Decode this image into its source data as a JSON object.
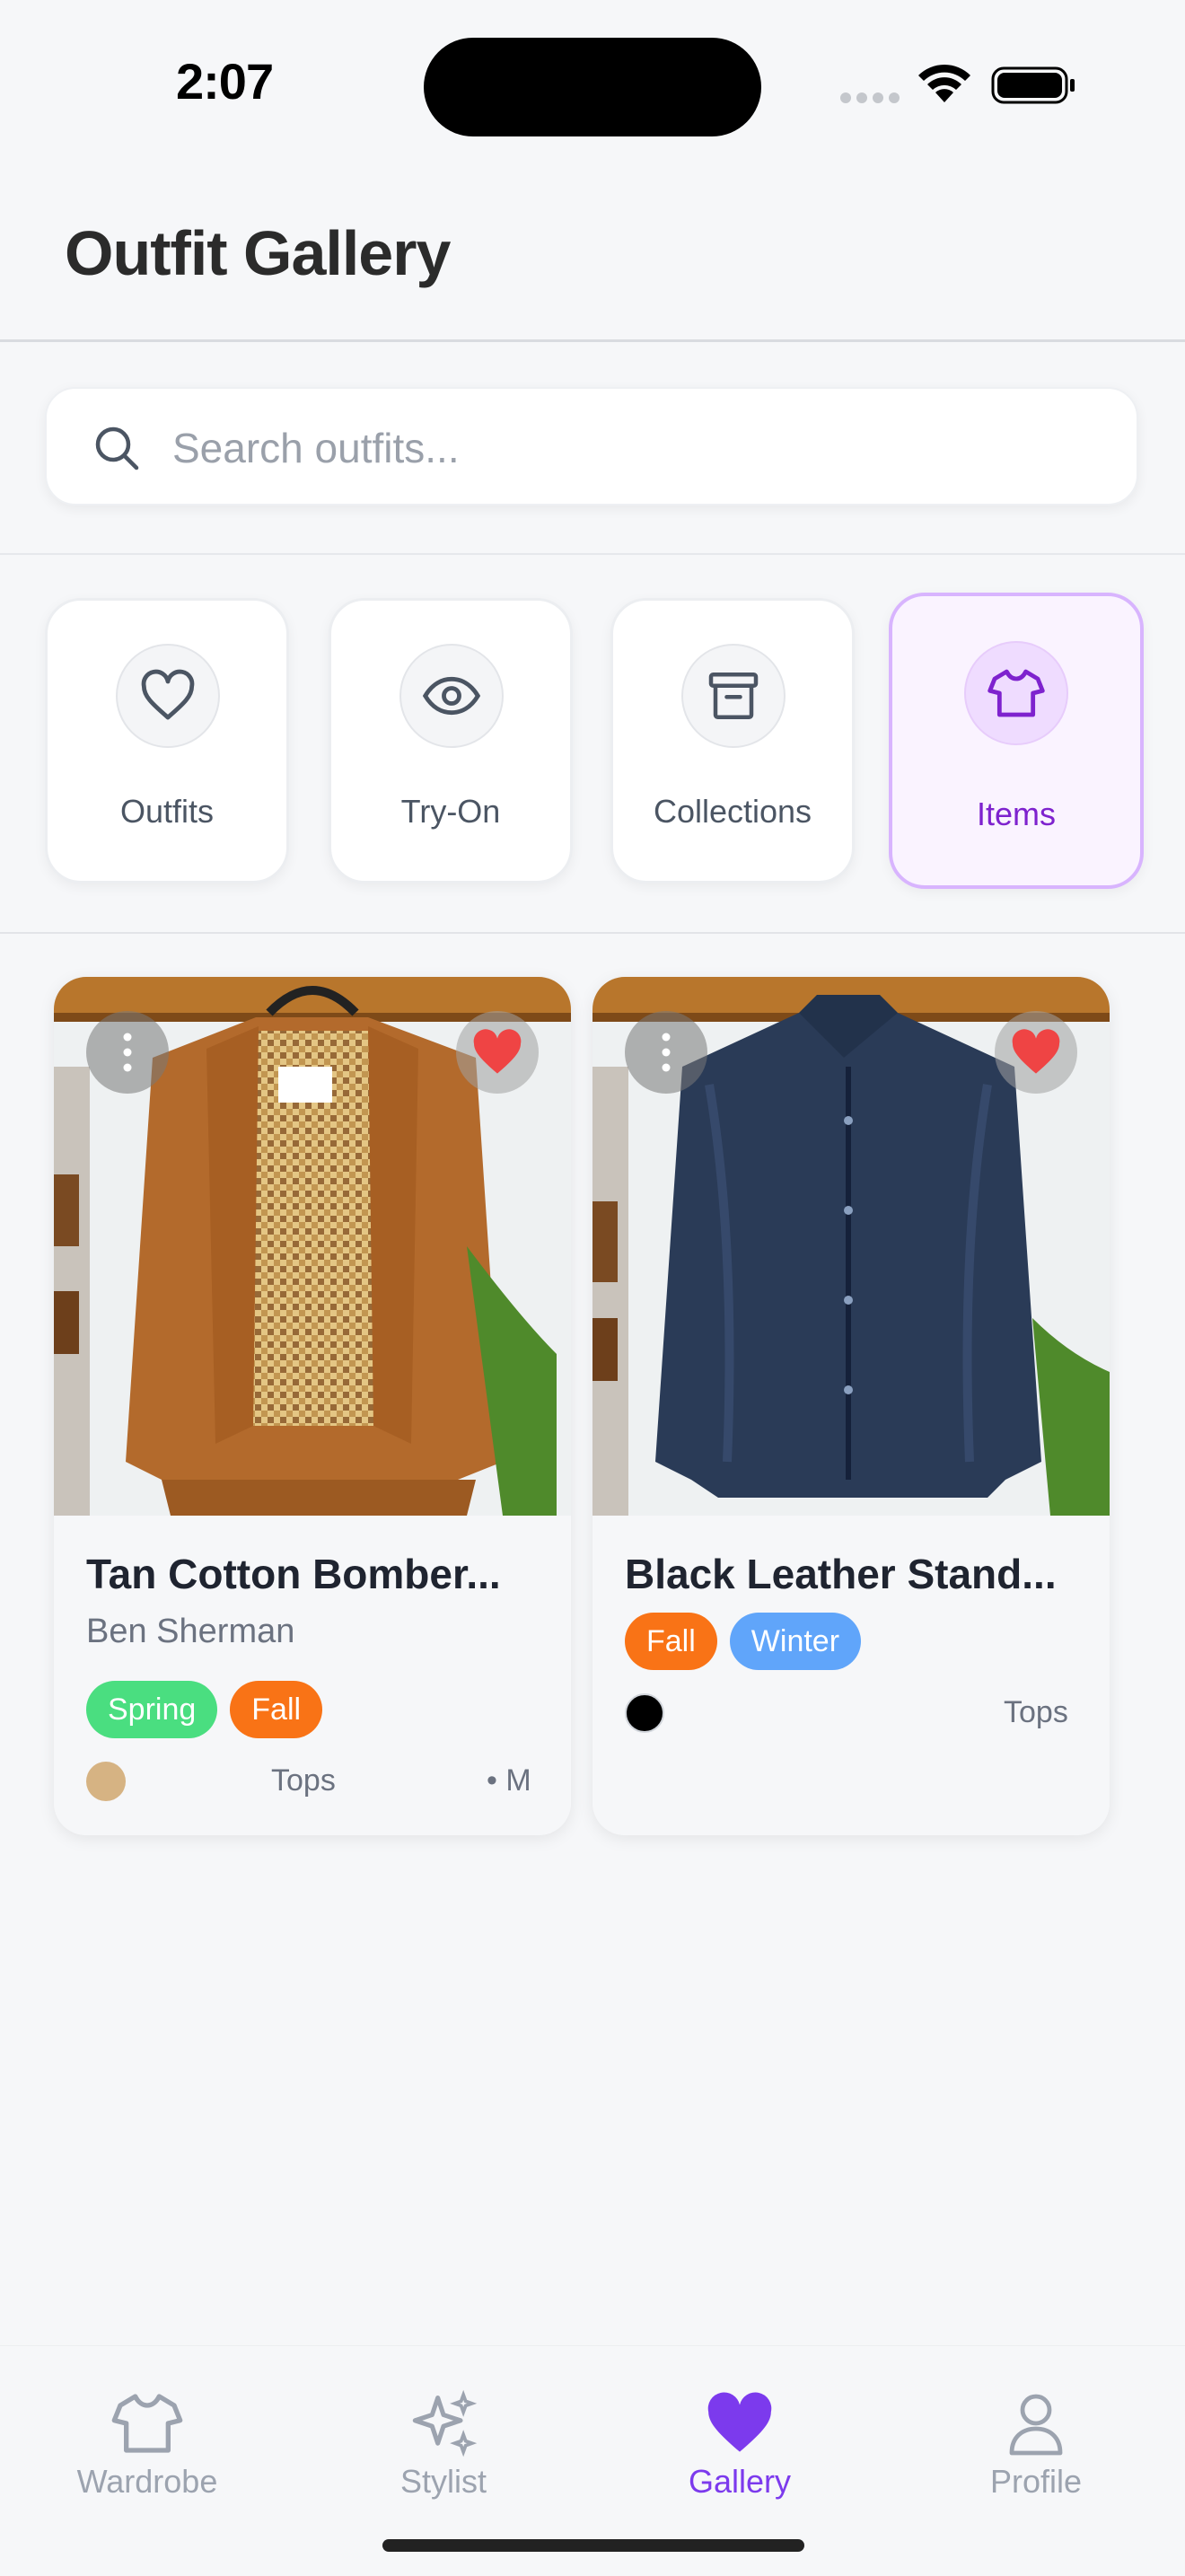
{
  "status": {
    "time": "2:07"
  },
  "header": {
    "title": "Outfit Gallery"
  },
  "search": {
    "placeholder": "Search outfits..."
  },
  "categories": [
    {
      "label": "Outfits",
      "icon": "heart-icon",
      "active": false
    },
    {
      "label": "Try-On",
      "icon": "eye-icon",
      "active": false
    },
    {
      "label": "Collections",
      "icon": "archive-icon",
      "active": false
    },
    {
      "label": "Items",
      "icon": "shirt-icon",
      "active": true
    }
  ],
  "items": [
    {
      "title": "Tan Cotton Bomber...",
      "brand": "Ben Sherman",
      "tags": [
        {
          "label": "Spring",
          "color": "#4ade80"
        },
        {
          "label": "Fall",
          "color": "#f97316"
        }
      ],
      "swatch_color": "#d6b383",
      "category": "Tops",
      "size": "• M",
      "favorite": true
    },
    {
      "title": "Black Leather Stand...",
      "brand": "",
      "tags": [
        {
          "label": "Fall",
          "color": "#f97316"
        },
        {
          "label": "Winter",
          "color": "#60a5fa"
        }
      ],
      "swatch_color": "#000000",
      "category": "Tops",
      "size": "",
      "favorite": true
    }
  ],
  "tabbar": [
    {
      "label": "Wardrobe",
      "icon": "shirt-icon",
      "active": false
    },
    {
      "label": "Stylist",
      "icon": "sparkles-icon",
      "active": false
    },
    {
      "label": "Gallery",
      "icon": "heart-icon",
      "active": true
    },
    {
      "label": "Profile",
      "icon": "person-icon",
      "active": false
    }
  ],
  "colors": {
    "accent": "#7c3aed",
    "favorite": "#ef4444"
  }
}
